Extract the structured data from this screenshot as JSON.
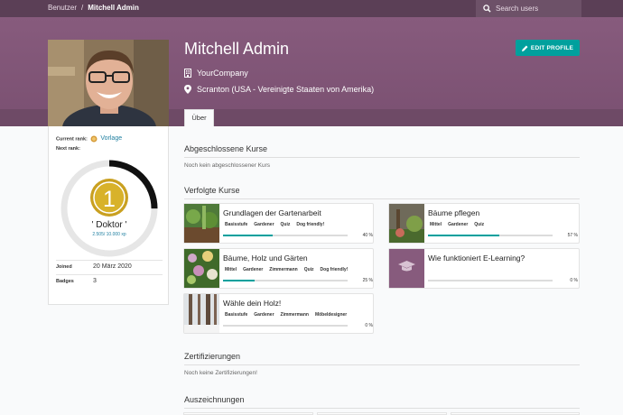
{
  "breadcrumb": {
    "parent": "Benutzer",
    "sep": "/",
    "current": "Mitchell Admin"
  },
  "search": {
    "placeholder": "Search users"
  },
  "profile": {
    "name": "Mitchell Admin",
    "company": "YourCompany",
    "location": "Scranton (USA - Vereinigte Staaten von Amerika)",
    "edit_label": "EDIT PROFILE",
    "tab_label": "Über"
  },
  "rank": {
    "current_label": "Current rank:",
    "current_value": "Vorlage",
    "next_label": "Next rank:",
    "level": "1",
    "title": "' Doktor '",
    "xp": "2.505/ 10.000 xp",
    "progress": 0.25
  },
  "stats": {
    "joined_label": "Joined",
    "joined_value": "20 März 2020",
    "badges_label": "Badges",
    "badges_value": "3"
  },
  "sections": {
    "completed_title": "Abgeschlossene Kurse",
    "completed_empty": "Noch kein abgeschlossener Kurs",
    "followed_title": "Verfolgte Kurse",
    "certs_title": "Zertifizierungen",
    "certs_empty": "Noch keine Zertifizierungen!",
    "awards_title": "Auszeichnungen"
  },
  "courses": [
    {
      "title": "Grundlagen der Gartenarbeit",
      "tags": [
        "Basisstufe",
        "Gardener",
        "Quiz",
        "Dog friendly!"
      ],
      "progress_label": "40 %",
      "progress": 0.4
    },
    {
      "title": "Bäume pflegen",
      "tags": [
        "Mittel",
        "Gardener",
        "Quiz"
      ],
      "progress_label": "57 %",
      "progress": 0.57
    },
    {
      "title": "Bäume, Holz und Gärten",
      "tags": [
        "Mittel",
        "Gardener",
        "Zimmermann",
        "Quiz",
        "Dog friendly!"
      ],
      "progress_label": "25 %",
      "progress": 0.25
    },
    {
      "title": "Wie funktioniert E-Learning?",
      "tags": [],
      "progress_label": "0 %",
      "progress": 0
    },
    {
      "title": "Wähle dein Holz!",
      "tags": [
        "Basisstufe",
        "Gardener",
        "Zimmermann",
        "Möbeldesigner"
      ],
      "progress_label": "0 %",
      "progress": 0
    }
  ],
  "colors": {
    "accent": "#00a09d",
    "header": "#875b7d",
    "topbar": "#5b3f56",
    "gold": "#c9a020"
  }
}
